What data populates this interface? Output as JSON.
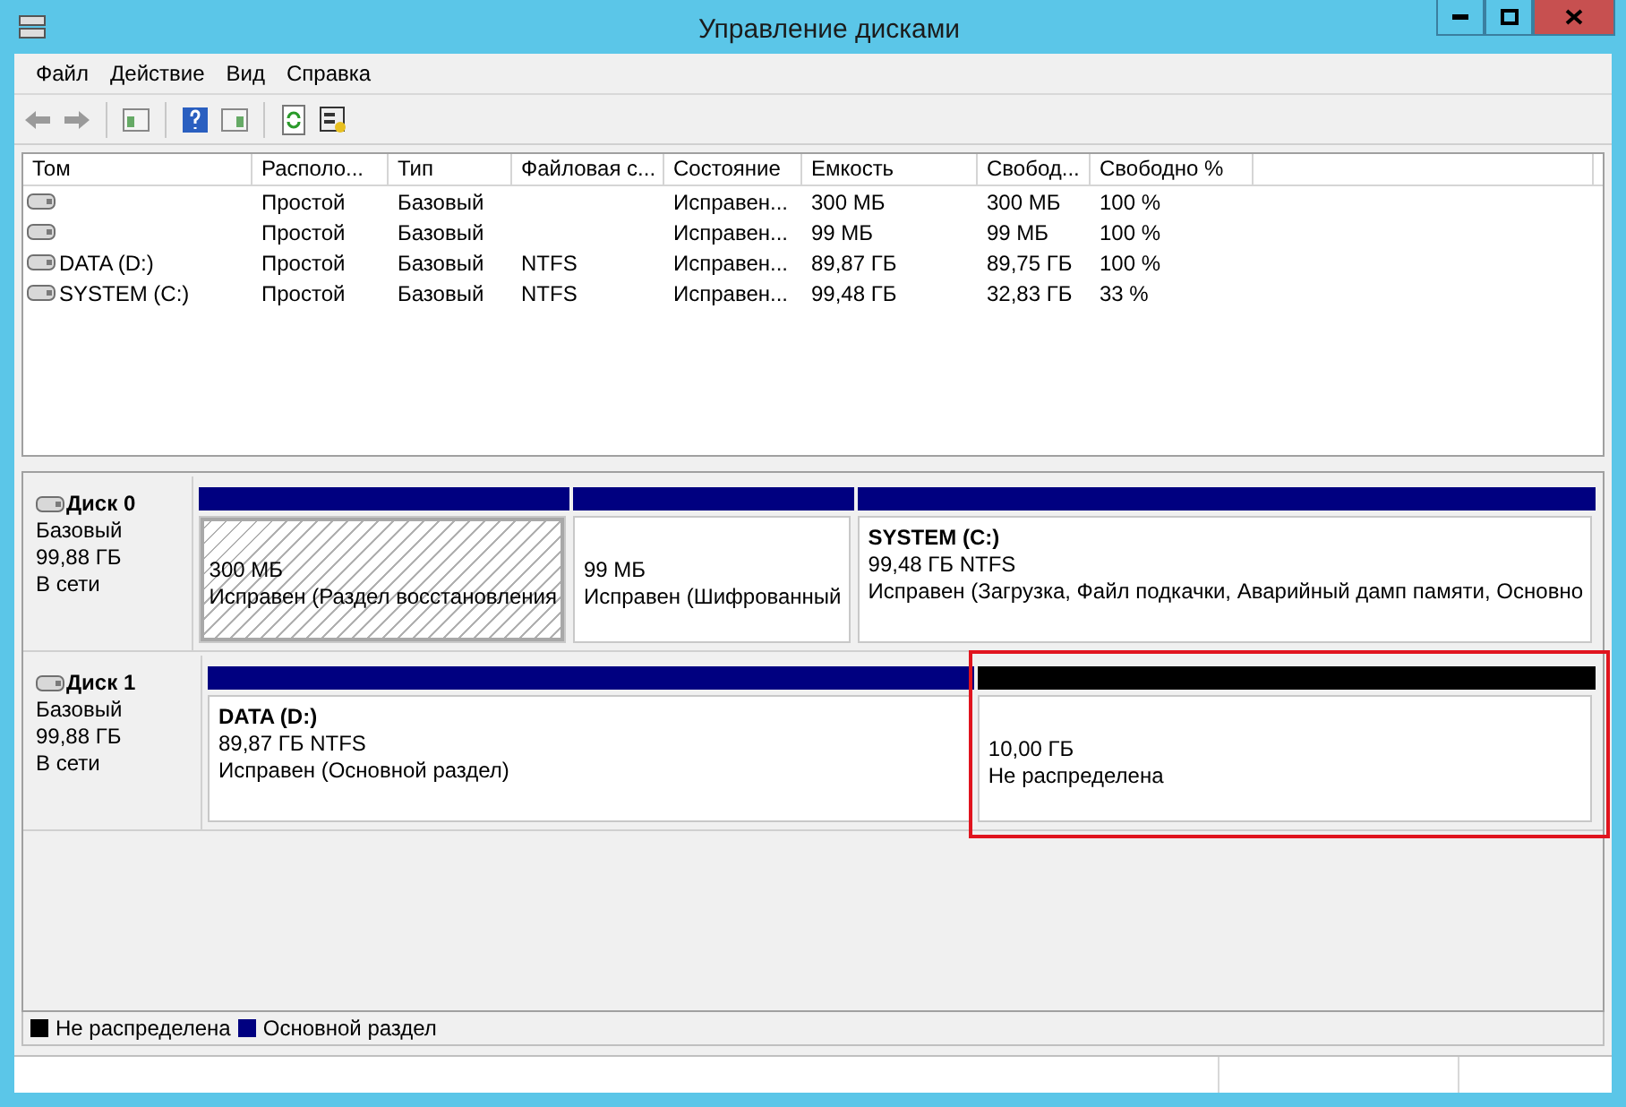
{
  "window": {
    "title": "Управление дисками"
  },
  "menu": [
    "Файл",
    "Действие",
    "Вид",
    "Справка"
  ],
  "table": {
    "columns": [
      "Том",
      "Располо...",
      "Тип",
      "Файловая с...",
      "Состояние",
      "Емкость",
      "Свобод...",
      "Свободно %"
    ],
    "rows": [
      {
        "cells": [
          "",
          "Простой",
          "Базовый",
          "",
          "Исправен...",
          "300 МБ",
          "300 МБ",
          "100 %"
        ]
      },
      {
        "cells": [
          "",
          "Простой",
          "Базовый",
          "",
          "Исправен...",
          "99 МБ",
          "99 МБ",
          "100 %"
        ]
      },
      {
        "cells": [
          "DATA (D:)",
          "Простой",
          "Базовый",
          "NTFS",
          "Исправен...",
          "89,87 ГБ",
          "89,75 ГБ",
          "100 %"
        ]
      },
      {
        "cells": [
          "SYSTEM (C:)",
          "Простой",
          "Базовый",
          "NTFS",
          "Исправен...",
          "99,48 ГБ",
          "32,83 ГБ",
          "33 %"
        ]
      }
    ]
  },
  "disks": [
    {
      "name": "Диск 0",
      "type": "Базовый",
      "size": "99,88 ГБ",
      "status": "В сети",
      "partitions": [
        {
          "size": "300 МБ",
          "status": "Исправен (Раздел восстановления",
          "color": "#000080",
          "hatched": true,
          "highlighted": false
        },
        {
          "size": "99 МБ",
          "status": "Исправен (Шифрованный",
          "color": "#000080",
          "hatched": false,
          "highlighted": false
        },
        {
          "label": "SYSTEM  (C:)",
          "size": "99,48 ГБ NTFS",
          "status": "Исправен (Загрузка, Файл подкачки, Аварийный дамп памяти, Основно",
          "color": "#000080",
          "hatched": false,
          "highlighted": false
        }
      ]
    },
    {
      "name": "Диск 1",
      "type": "Базовый",
      "size": "99,88 ГБ",
      "status": "В сети",
      "partitions": [
        {
          "label": "DATA  (D:)",
          "size": "89,87 ГБ NTFS",
          "status": "Исправен (Основной раздел)",
          "color": "#000080",
          "hatched": false,
          "highlighted": false
        },
        {
          "size": "10,00 ГБ",
          "status": "Не распределена",
          "color": "#000000",
          "hatched": false,
          "highlighted": true
        }
      ]
    }
  ],
  "legend": [
    {
      "label": "Не распределена",
      "color": "#000000"
    },
    {
      "label": "Основной раздел",
      "color": "#000080"
    }
  ]
}
